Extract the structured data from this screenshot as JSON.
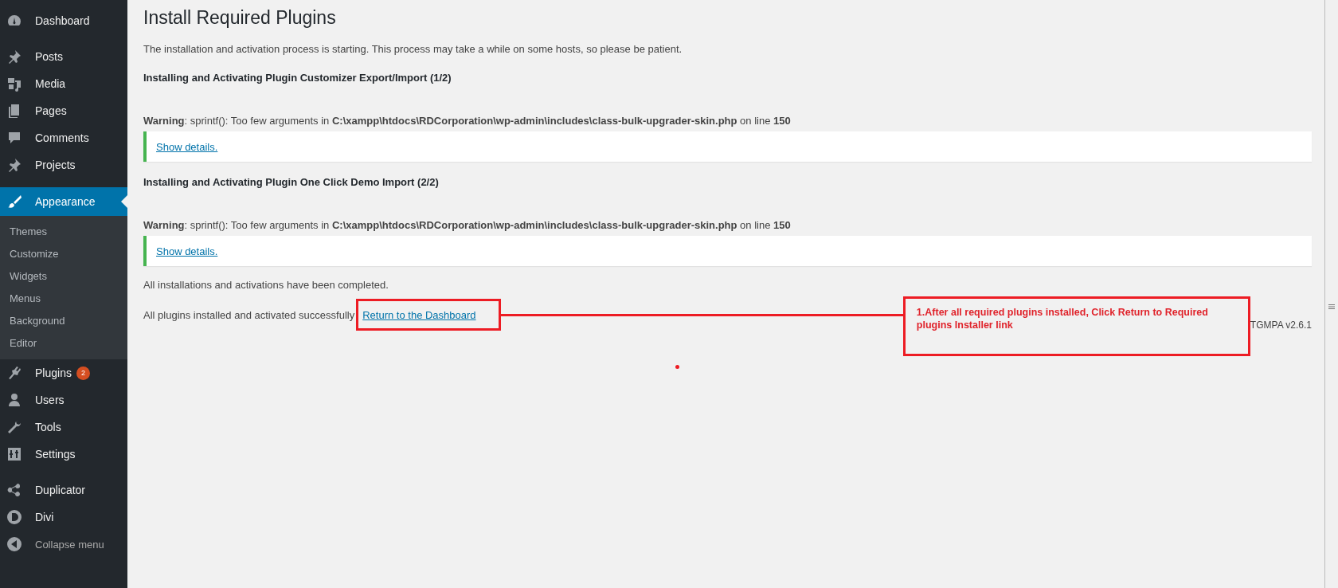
{
  "sidebar": {
    "groups": [
      {
        "items": [
          {
            "kind": "menu",
            "label": "Dashboard",
            "selected": false
          }
        ]
      },
      {
        "items": [
          {
            "kind": "menu",
            "label": "Posts",
            "selected": false
          },
          {
            "kind": "menu",
            "label": "Media",
            "selected": false
          },
          {
            "kind": "menu",
            "label": "Pages",
            "selected": false
          },
          {
            "kind": "menu",
            "label": "Comments",
            "selected": false
          },
          {
            "kind": "menu",
            "label": "Projects",
            "selected": false
          }
        ]
      },
      {
        "items": [
          {
            "kind": "menu",
            "label": "Appearance",
            "selected": true,
            "expanded": true,
            "children": [
              {
                "label": "Themes",
                "selected": false
              },
              {
                "label": "Customize",
                "selected": false
              },
              {
                "label": "Widgets",
                "selected": false
              },
              {
                "label": "Menus",
                "selected": false
              },
              {
                "label": "Background",
                "selected": false
              },
              {
                "label": "Editor",
                "selected": false
              }
            ]
          },
          {
            "kind": "menu",
            "label": "Plugins",
            "selected": false,
            "badge": "2"
          },
          {
            "kind": "menu",
            "label": "Users",
            "selected": false
          },
          {
            "kind": "menu",
            "label": "Tools",
            "selected": false
          },
          {
            "kind": "menu",
            "label": "Settings",
            "selected": false
          }
        ]
      },
      {
        "items": [
          {
            "kind": "menu",
            "label": "Duplicator",
            "selected": false
          },
          {
            "kind": "menu",
            "label": "Divi",
            "selected": false
          },
          {
            "kind": "collapse",
            "label": "Collapse menu",
            "selected": false
          }
        ]
      }
    ]
  },
  "page": {
    "title": "Install Required Plugins",
    "intro": "The installation and activation process is starting. This process may take a while on some hosts, so please be patient.",
    "steps": [
      {
        "heading": "Installing and Activating Plugin Customizer Export/Import (1/2)",
        "warning": "**Warning**: sprintf(): Too few arguments in **C:\\xampp\\htdocs\\RDCorporation\\wp-admin\\includes\\class-bulk-upgrader-skin.php** on line **150**",
        "details_link": "Show details."
      },
      {
        "heading": "Installing and Activating Plugin One Click Demo Import (2/2)",
        "warning": "**Warning**: sprintf(): Too few arguments in **C:\\xampp\\htdocs\\RDCorporation\\wp-admin\\includes\\class-bulk-upgrader-skin.php** on line **150**",
        "details_link": "Show details."
      }
    ],
    "completed": "All installations and activations have been completed.",
    "success_text": "All plugins installed and activated successfully",
    "return_link": "Return to the Dashboard",
    "version": "TGMPA v2.6.1"
  },
  "annotation": {
    "text": "1.After all required plugins installed, Click Return to Required plugins Installer link"
  }
}
